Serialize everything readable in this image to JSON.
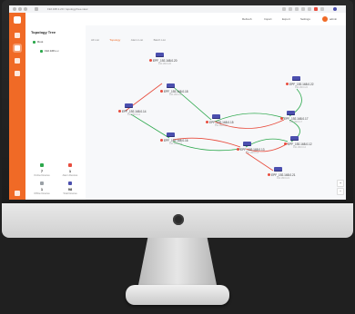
{
  "browser": {
    "url": "192.168.1.20 / topology/tree-view"
  },
  "header": {
    "actions": [
      "Refresh",
      "Import",
      "Export",
      "Settings"
    ],
    "user": "admin"
  },
  "tree": {
    "title": "Topology Tree",
    "items": [
      {
        "label": "Root"
      },
      {
        "label": "192.168.x.x"
      }
    ]
  },
  "stats": [
    {
      "value": "7",
      "label": "Online Devices",
      "color": "#2ca84c"
    },
    {
      "value": "1",
      "label": "Alarm Devices",
      "color": "#e84c3d"
    },
    {
      "value": "1",
      "label": "Offline Devices",
      "color": "#9aa0a6"
    },
    {
      "value": "98",
      "label": "Total Devices",
      "color": "#4b4fae"
    }
  ],
  "tabs": [
    {
      "label": "All List"
    },
    {
      "label": "Topology",
      "active": true
    },
    {
      "label": "Alarm List"
    },
    {
      "label": "Batch List"
    }
  ],
  "devices": [
    {
      "name": "EPF_192.168.0.20",
      "sub": "192.168.0.20"
    },
    {
      "name": "EPF_192.168.0.18",
      "sub": "192.168.0.18"
    },
    {
      "name": "EPF_192.168.0.16",
      "sub": "192.168.0.16"
    },
    {
      "name": "EPF_192.168.0.14",
      "sub": "192.168.0.14"
    },
    {
      "name": "EPF_192.168.0.15",
      "sub": "192.168.0.15"
    },
    {
      "name": "EPF_192.168.0.17",
      "sub": "192.168.0.17"
    },
    {
      "name": "EPF_192.168.0.13",
      "sub": "192.168.0.13"
    },
    {
      "name": "EPF_192.168.0.12",
      "sub": "192.168.0.12"
    },
    {
      "name": "EPF_192.168.0.22",
      "sub": "192.168.0.22"
    },
    {
      "name": "EPF_192.168.0.21",
      "sub": "192.168.0.21"
    }
  ],
  "colors": {
    "accent": "#f06a26",
    "link_ok": "#2ca84c",
    "link_alarm": "#e84c3d",
    "device": "#4b4fae"
  }
}
